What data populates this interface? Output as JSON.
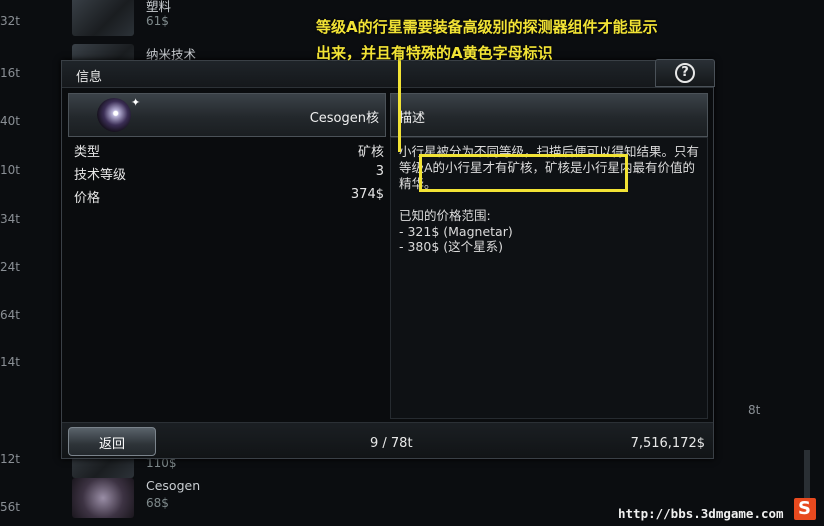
{
  "background": {
    "side_labels_left": [
      "32t",
      "16t",
      "40t",
      "10t",
      "34t",
      "24t",
      "64t",
      "14t",
      "12t",
      "56t"
    ],
    "side_label_right": "8t",
    "items": [
      {
        "name": "塑料",
        "price": "61$"
      },
      {
        "name": "纳米技术",
        "price": ""
      },
      {
        "name": "",
        "price": "110$"
      },
      {
        "name": "Cesogen",
        "price": "68$"
      }
    ]
  },
  "annotation": {
    "line1": "等级A的行星需要装备高级别的探测器组件才能显示",
    "line2": "出来，并且有特殊的A黄色字母标识"
  },
  "dialog": {
    "title": "信息",
    "help_glyph": "?",
    "item_name": "Cesogen核",
    "properties": [
      {
        "key": "类型",
        "value": "矿核"
      },
      {
        "key": "技术等级",
        "value": "3"
      },
      {
        "key": "价格",
        "value": "374$"
      }
    ],
    "desc_header": "描述",
    "description": "小行星被分为不同等级，扫描后便可以得知结果。只有等级A的小行星才有矿核，矿核是小行星内最有价值的精华。",
    "range_title": "已知的价格范围:",
    "ranges": [
      "- 321$ (Magnetar)",
      "- 380$ (这个星系)"
    ],
    "back_label": "返回",
    "cargo": "9 / 78t",
    "money": "7,516,172$"
  },
  "watermark": "http://bbs.3dmgame.com",
  "colors": {
    "highlight": "#f2e335",
    "background": "#0b0d10"
  }
}
